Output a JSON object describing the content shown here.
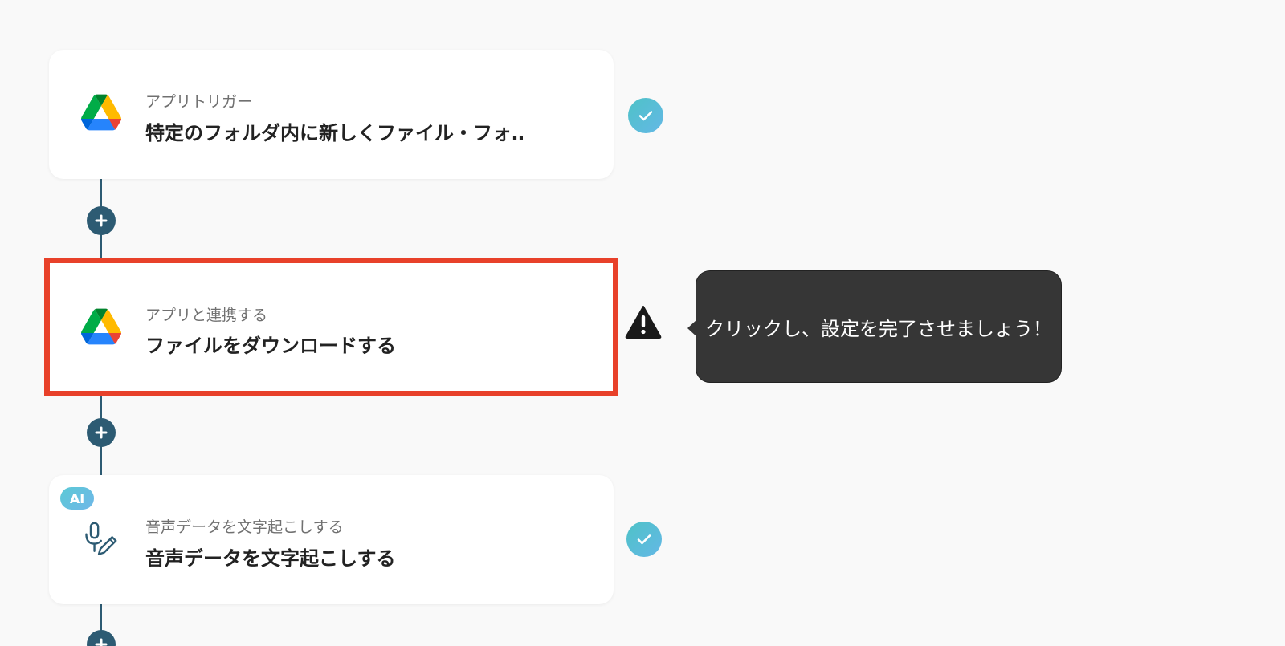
{
  "flow": {
    "steps": [
      {
        "subtitle": "アプリトリガー",
        "title": "特定のフォルダ内に新しくファイル・フォ…",
        "icon": "google-drive-icon",
        "status": "complete"
      },
      {
        "subtitle": "アプリと連携する",
        "title": "ファイルをダウンロードする",
        "icon": "google-drive-icon",
        "status": "warning",
        "highlighted": true
      },
      {
        "badge": "AI",
        "subtitle": "音声データを文字起こしする",
        "title": "音声データを文字起こしする",
        "icon": "microphone-pen-icon",
        "status": "complete"
      }
    ]
  },
  "tooltip": {
    "text": "クリックし、設定を完了させましょう！"
  },
  "colors": {
    "background": "#f9f9f9",
    "connector": "#2d5b73",
    "highlight": "#e8412a",
    "check": "#4ec2c7",
    "tooltip_bg": "#363636"
  }
}
